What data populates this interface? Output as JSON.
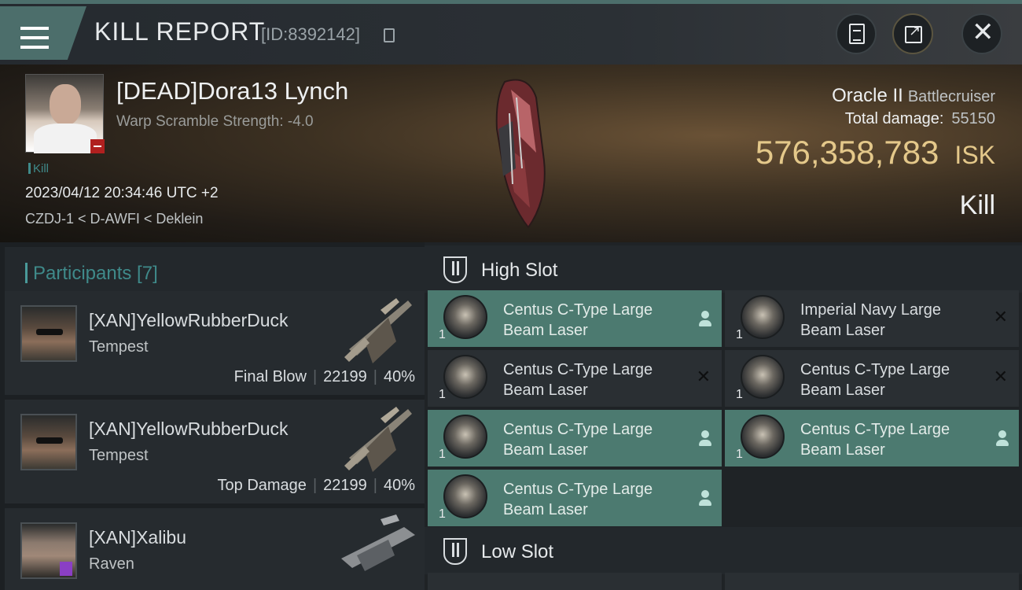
{
  "window": {
    "title": "KILL REPORT",
    "report_id": "[ID:8392142]"
  },
  "victim": {
    "name": "[DEAD]Dora13 Lynch",
    "warp_scramble": "Warp Scramble Strength: -4.0",
    "kill_tag": "Kill",
    "datetime": "2023/04/12 20:34:46 UTC +2",
    "location": "CZDJ-1 < D-AWFI < Deklein"
  },
  "ship": {
    "name": "Oracle II",
    "class": "Battlecruiser",
    "total_damage_label": "Total damage:",
    "total_damage": "55150",
    "isk_value": "576,358,783",
    "isk_unit": "ISK",
    "result": "Kill"
  },
  "participants": {
    "title": "Participants [7]",
    "items": [
      {
        "name": "[XAN]YellowRubberDuck",
        "ship": "Tempest",
        "tag": "Final Blow",
        "damage": "22199",
        "percent": "40%"
      },
      {
        "name": "[XAN]YellowRubberDuck",
        "ship": "Tempest",
        "tag": "Top Damage",
        "damage": "22199",
        "percent": "40%"
      },
      {
        "name": "[XAN]Xalibu",
        "ship": "Raven"
      }
    ]
  },
  "slots": {
    "high_title": "High Slot",
    "low_title": "Low Slot",
    "high": [
      {
        "qty": "1",
        "name": "Centus C-Type Large Beam Laser",
        "status": "person"
      },
      {
        "qty": "1",
        "name": "Imperial Navy Large Beam Laser",
        "status": "destroyed"
      },
      {
        "qty": "1",
        "name": "Centus C-Type Large Beam Laser",
        "status": "destroyed"
      },
      {
        "qty": "1",
        "name": "Centus C-Type Large Beam Laser",
        "status": "destroyed"
      },
      {
        "qty": "1",
        "name": "Centus C-Type Large Beam Laser",
        "status": "person"
      },
      {
        "qty": "1",
        "name": "Centus C-Type Large Beam Laser",
        "status": "person"
      },
      {
        "qty": "1",
        "name": "Centus C-Type Large Beam Laser",
        "status": "person"
      }
    ]
  },
  "colors": {
    "accent_teal": "#4c6e6b",
    "isk_gold": "#e4c88a",
    "dropped_module": "#4c7a70",
    "dead_flag": "#b0201f"
  },
  "icons": [
    "menu-icon",
    "copy-icon",
    "clipboard-icon",
    "share-icon",
    "close-icon",
    "high-slot-icon",
    "low-slot-icon",
    "person-icon",
    "destroyed-x-icon"
  ]
}
